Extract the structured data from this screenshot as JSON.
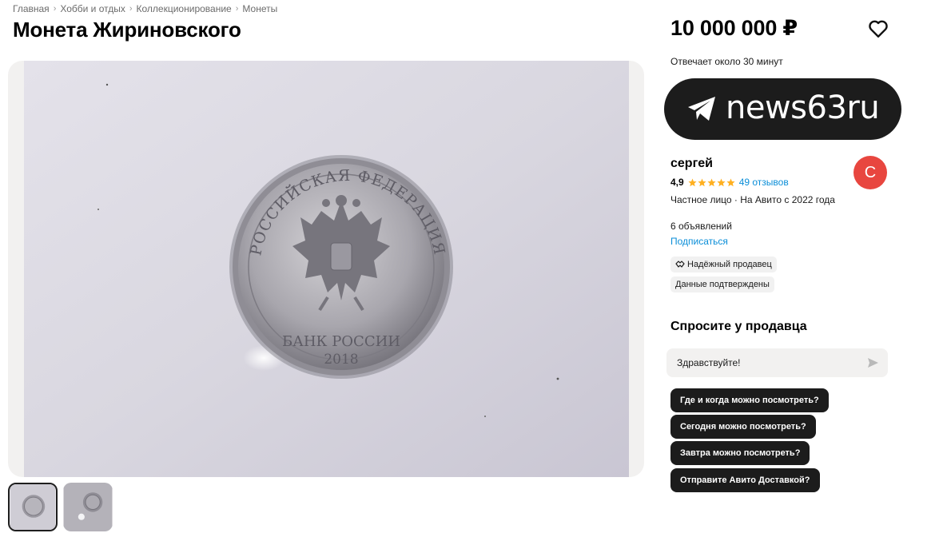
{
  "breadcrumbs": [
    "Главная",
    "Хобби и отдых",
    "Коллекционирование",
    "Монеты"
  ],
  "title": "Монета Жириновского",
  "coin": {
    "top_text": "РОССИЙСКАЯ ФЕДЕРАЦИЯ",
    "bank_text": "БАНК РОССИИ",
    "year": "2018"
  },
  "gallery": {
    "thumb_count": 2,
    "active_index": 0
  },
  "price": "10 000 000 ₽",
  "reply_time": "Отвечает около 30 минут",
  "watermark": "news63ru",
  "seller": {
    "name": "сергей",
    "avatar_letter": "С",
    "rating": "4,9",
    "stars": 5,
    "reviews": "49 отзывов",
    "type": "Частное лицо · На Авито с 2022 года",
    "ads": "6 объявлений",
    "subscribe": "Подписаться",
    "badges": [
      "Надёжный продавец",
      "Данные подтверждены"
    ]
  },
  "ask": {
    "title": "Спросите у продавца",
    "message_value": "Здравствуйте!",
    "questions": [
      "Где и когда можно посмотреть?",
      "Сегодня можно посмотреть?",
      "Завтра можно посмотреть?",
      "Отправите Авито Доставкой?"
    ]
  },
  "colors": {
    "accent_link": "#0a8ed8",
    "avatar_bg": "#e8463f",
    "star": "#ffb021",
    "button_dark": "#1c1c1c"
  }
}
